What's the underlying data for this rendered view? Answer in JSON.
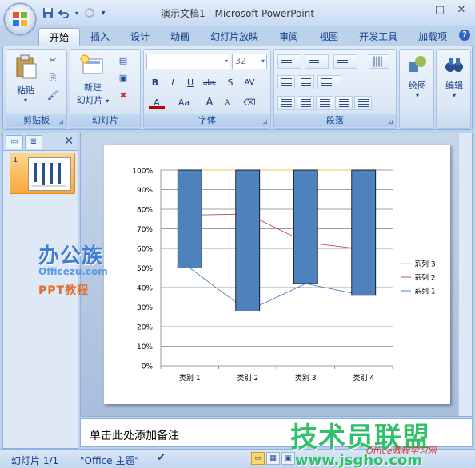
{
  "window": {
    "title": "演示文稿1 - Microsoft PowerPoint",
    "controls": [
      "—",
      "□",
      "✕"
    ]
  },
  "qat": {
    "save": "save-icon",
    "undo": "undo-icon",
    "redo": "redo-icon",
    "customize": "▾"
  },
  "tabs": [
    "开始",
    "插入",
    "设计",
    "动画",
    "幻灯片放映",
    "审阅",
    "视图",
    "开发工具",
    "加载项"
  ],
  "active_tab": "开始",
  "ribbon": {
    "clipboard": {
      "label": "剪贴板",
      "paste": "粘贴"
    },
    "slides": {
      "label": "幻灯片",
      "new_slide_line1": "新建",
      "new_slide_line2": "幻灯片",
      "dropdown": "▾"
    },
    "font": {
      "label": "字体",
      "font_name": "",
      "font_size": "32",
      "bold": "B",
      "italic": "I",
      "underline": "U",
      "strike": "abc",
      "shadow": "S",
      "spacing": "AV",
      "color": "A",
      "case": "Aa",
      "grow": "A",
      "shrink": "A"
    },
    "paragraph": {
      "label": "段落"
    },
    "drawing": {
      "label": "绘图"
    },
    "editing": {
      "label": "编辑"
    }
  },
  "left_pane": {
    "slide_number": "1",
    "close": "✕",
    "logo_text": "办公族",
    "logo_url": "Officezu.com",
    "logo_sub": "PPT教程"
  },
  "notes": {
    "placeholder": "单击此处添加备注"
  },
  "status": {
    "slide_info": "幻灯片 1/1",
    "theme": "\"Office 主题\""
  },
  "site_watermark": {
    "main": "技术员联盟",
    "url": "www.jsgho.com",
    "small": "Office教程学习网"
  },
  "chart_data": {
    "type": "bar+line",
    "categories": [
      "类别 1",
      "类别 2",
      "类别 3",
      "类别 4"
    ],
    "ylim": [
      0,
      100
    ],
    "yticks": [
      "0%",
      "10%",
      "20%",
      "30%",
      "40%",
      "50%",
      "60%",
      "70%",
      "80%",
      "90%",
      "100%"
    ],
    "bars": [
      {
        "low": 50,
        "high": 100
      },
      {
        "low": 28,
        "high": 100
      },
      {
        "low": 42,
        "high": 100
      },
      {
        "low": 36,
        "high": 100
      }
    ],
    "series": [
      {
        "name": "系列 3",
        "values": [
          100,
          100,
          100,
          100
        ],
        "color": "#f2c75c"
      },
      {
        "name": "系列 2",
        "values": [
          77,
          77.5,
          63,
          59.5
        ],
        "color": "#c0504d"
      },
      {
        "name": "系列 1",
        "values": [
          50,
          28,
          42,
          36
        ],
        "color": "#4f81bd"
      }
    ],
    "bar_color": "#4f81bd",
    "grid": true,
    "legend": "right"
  }
}
